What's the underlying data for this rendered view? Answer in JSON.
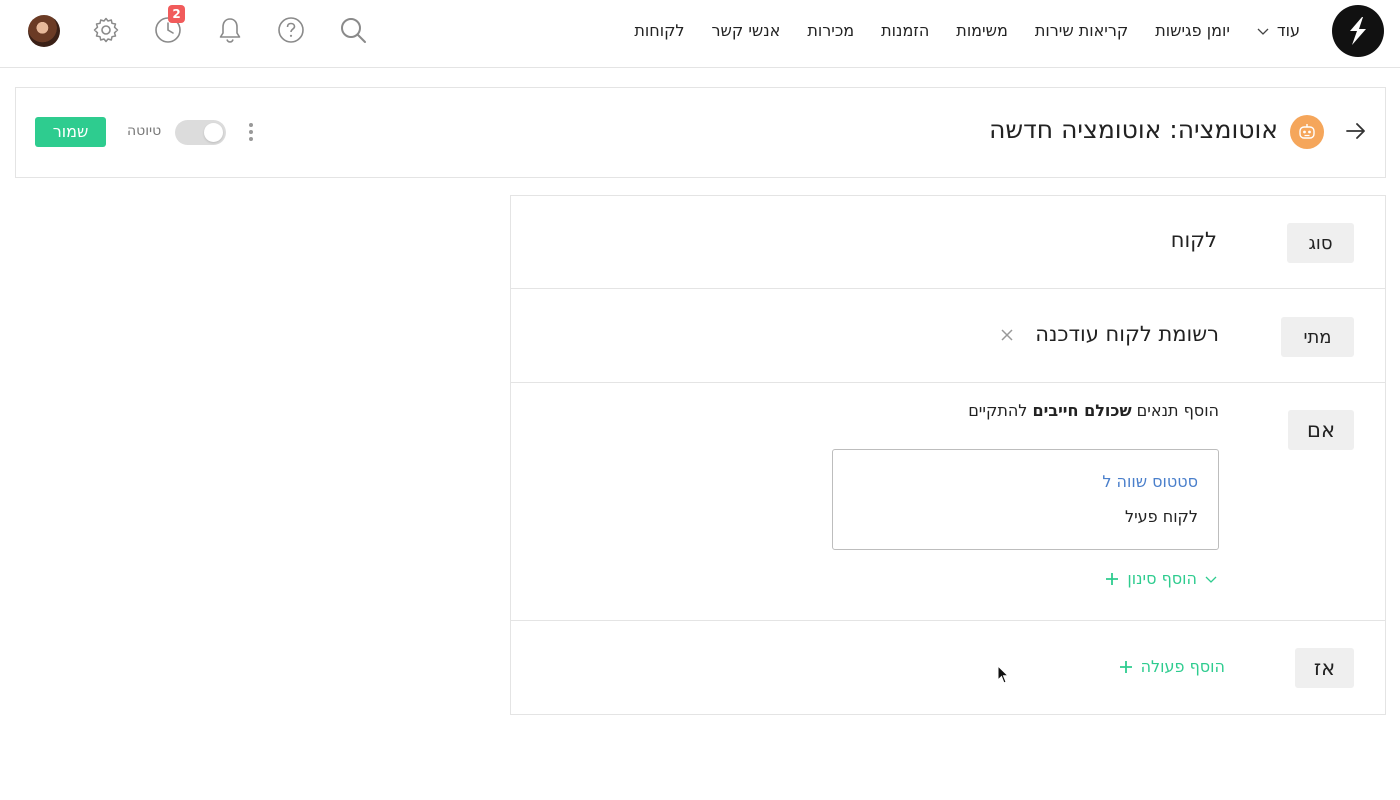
{
  "nav": {
    "items": [
      "לקוחות",
      "אנשי קשר",
      "מכירות",
      "הזמנות",
      "משימות",
      "קריאות שירות",
      "יומן פגישות"
    ],
    "more_label": "עוד",
    "history_badge": "2"
  },
  "header": {
    "title": "אוטומציה: אוטומציה חדשה",
    "draft_label": "טיוטה",
    "save_label": "שמור"
  },
  "rule": {
    "type": {
      "label": "סוג",
      "value": "לקוח"
    },
    "when": {
      "label": "מתי",
      "value": "רשומת לקוח עודכנה"
    },
    "if": {
      "label": "אם",
      "intro_prefix": "הוסף תנאים",
      "intro_bold": "שכולם חייבים",
      "intro_suffix": "להתקיים",
      "condition_field": "סטטוס שווה ל",
      "condition_value": "לקוח פעיל",
      "add_filter_label": "הוסף סינון"
    },
    "then": {
      "label": "אז",
      "add_action_label": "הוסף פעולה"
    }
  },
  "colors": {
    "accent_green": "#2ecc8f",
    "link_blue": "#4a7fcb",
    "badge_red": "#f15b5b",
    "bot_orange": "#f5a65b"
  }
}
